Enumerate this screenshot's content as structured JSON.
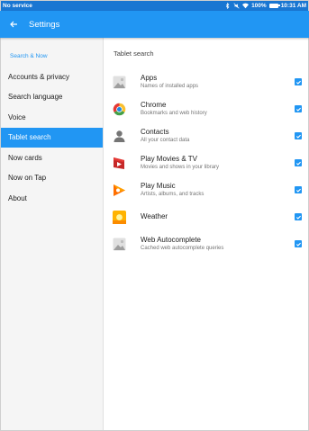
{
  "status_bar": {
    "carrier": "No service",
    "battery_percent": "100%",
    "time": "10:31 AM"
  },
  "app_bar": {
    "title": "Settings",
    "back_icon": "back-arrow-icon"
  },
  "sidebar": {
    "header": "Search & Now",
    "items": [
      {
        "label": "Accounts & privacy",
        "selected": false
      },
      {
        "label": "Search language",
        "selected": false
      },
      {
        "label": "Voice",
        "selected": false
      },
      {
        "label": "Tablet search",
        "selected": true
      },
      {
        "label": "Now cards",
        "selected": false
      },
      {
        "label": "Now on Tap",
        "selected": false
      },
      {
        "label": "About",
        "selected": false
      }
    ]
  },
  "content": {
    "title": "Tablet search",
    "rows": [
      {
        "title": "Apps",
        "subtitle": "Names of installed apps",
        "icon": "apps-icon",
        "checked": true
      },
      {
        "title": "Chrome",
        "subtitle": "Bookmarks and web history",
        "icon": "chrome-icon",
        "checked": true
      },
      {
        "title": "Contacts",
        "subtitle": "All your contact data",
        "icon": "contacts-icon",
        "checked": true
      },
      {
        "title": "Play Movies & TV",
        "subtitle": "Movies and shows in your library",
        "icon": "play-movies-icon",
        "checked": true
      },
      {
        "title": "Play Music",
        "subtitle": "Artists, albums, and tracks",
        "icon": "play-music-icon",
        "checked": true
      },
      {
        "title": "Weather",
        "subtitle": "",
        "icon": "weather-icon",
        "checked": true
      },
      {
        "title": "Web Autocomplete",
        "subtitle": "Cached web autocomplete queries",
        "icon": "web-autocomplete-icon",
        "checked": true
      }
    ]
  },
  "colors": {
    "primary": "#2196f3",
    "status_bar": "#1976d2",
    "sidebar_bg": "#f5f5f5"
  }
}
